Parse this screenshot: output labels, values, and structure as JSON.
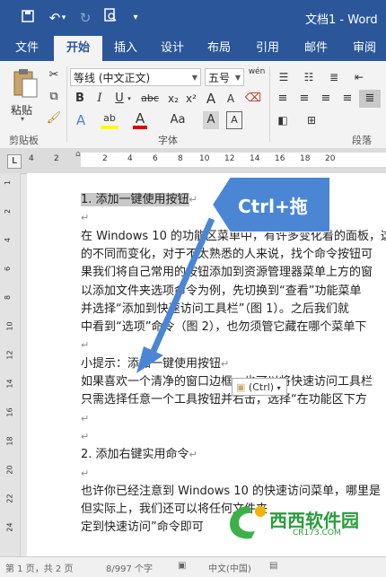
{
  "titlebar": {
    "doc_title": "文档1 - Word"
  },
  "tabs": [
    {
      "label": "文件"
    },
    {
      "label": "开始"
    },
    {
      "label": "插入"
    },
    {
      "label": "设计"
    },
    {
      "label": "布局"
    },
    {
      "label": "引用"
    },
    {
      "label": "邮件"
    },
    {
      "label": "审阅"
    }
  ],
  "ribbon": {
    "paste_label": "粘贴",
    "font_name": "等线 (中文正文)",
    "font_size": "五号",
    "wen_label": "wén",
    "groups": {
      "clipboard": "剪贴板",
      "font": "字体",
      "paragraph": "段落"
    },
    "bold": "B",
    "italic": "I",
    "underline": "U",
    "strike": "abc",
    "sub": "x₂",
    "sup": "x²",
    "text_effects": "A",
    "highlight": "ab",
    "font_color": "A",
    "aa_label": "Aa",
    "char_shade": "A",
    "grow": "A",
    "shrink": "A"
  },
  "ruler": {
    "numbers": [
      "4",
      "2",
      "",
      "2",
      "4",
      "6",
      "8",
      "10",
      "12",
      "14",
      "16",
      "18",
      "20"
    ]
  },
  "vruler": {
    "numbers": [
      "1",
      "2",
      "4",
      "6",
      "8",
      "10",
      "12",
      "14",
      "16",
      "18",
      "20",
      "22",
      "24"
    ]
  },
  "document": {
    "lines": [
      {
        "text": "1.  添加一键使用按钮",
        "selected": true,
        "mark": "↵"
      },
      {
        "text": "",
        "mark": "↵"
      },
      {
        "text": "在 Windows 10 的功能区菜单中，有许多变化着的面板，这",
        "mark": ""
      },
      {
        "text": "的不同而变化，对于不太熟悉的人来说，找个命令按钮可",
        "mark": ""
      },
      {
        "text": "果我们将自己常用的按钮添加到资源管理器菜单上方的窗",
        "mark": ""
      },
      {
        "text": "以添加文件夹选项命令为例，先切换到“查看”功能菜单",
        "mark": ""
      },
      {
        "text": "并选择“添加到快速访问工具栏”（图 1）。之后我们就",
        "mark": ""
      },
      {
        "text": "中看到“选项”命令（图 2），也勿须管它藏在哪个菜单下",
        "mark": ""
      },
      {
        "text": "",
        "mark": "↵"
      },
      {
        "text": "小提示：添加一键使用按钮",
        "mark": "↵"
      },
      {
        "text": "如果喜欢一个清净的窗口边框，也可以将快速访问工具栏",
        "mark": ""
      },
      {
        "text": "只需选择任意一个工具按钮并右击，选择“在功能区下方",
        "mark": ""
      },
      {
        "text": "",
        "mark": "↵"
      },
      {
        "text": "",
        "mark": "↵"
      },
      {
        "text": "2.  添加右键实用命令",
        "mark": "↵"
      },
      {
        "text": "",
        "mark": "↵"
      },
      {
        "text": "也许你已经注意到 Windows 10 的快速访问菜单，哪里是",
        "mark": ""
      },
      {
        "text": "但实际上，我们还可以将任何文件夹",
        "mark": ""
      },
      {
        "text": "定到快速访问”命令即可",
        "mark": ""
      }
    ]
  },
  "callout": {
    "text": "Ctrl+拖"
  },
  "paste_popup": {
    "text": "(Ctrl)"
  },
  "watermark": {
    "text": "西西软件园",
    "url": "CR173.COM"
  },
  "status": {
    "page": "第 1 页，共 2 页",
    "words": "8/997 个字",
    "lang": "中文(中国)"
  },
  "colors": {
    "accent": "#2b579a",
    "callout": "#4a86d4",
    "watermark": "#2a9d3b"
  }
}
